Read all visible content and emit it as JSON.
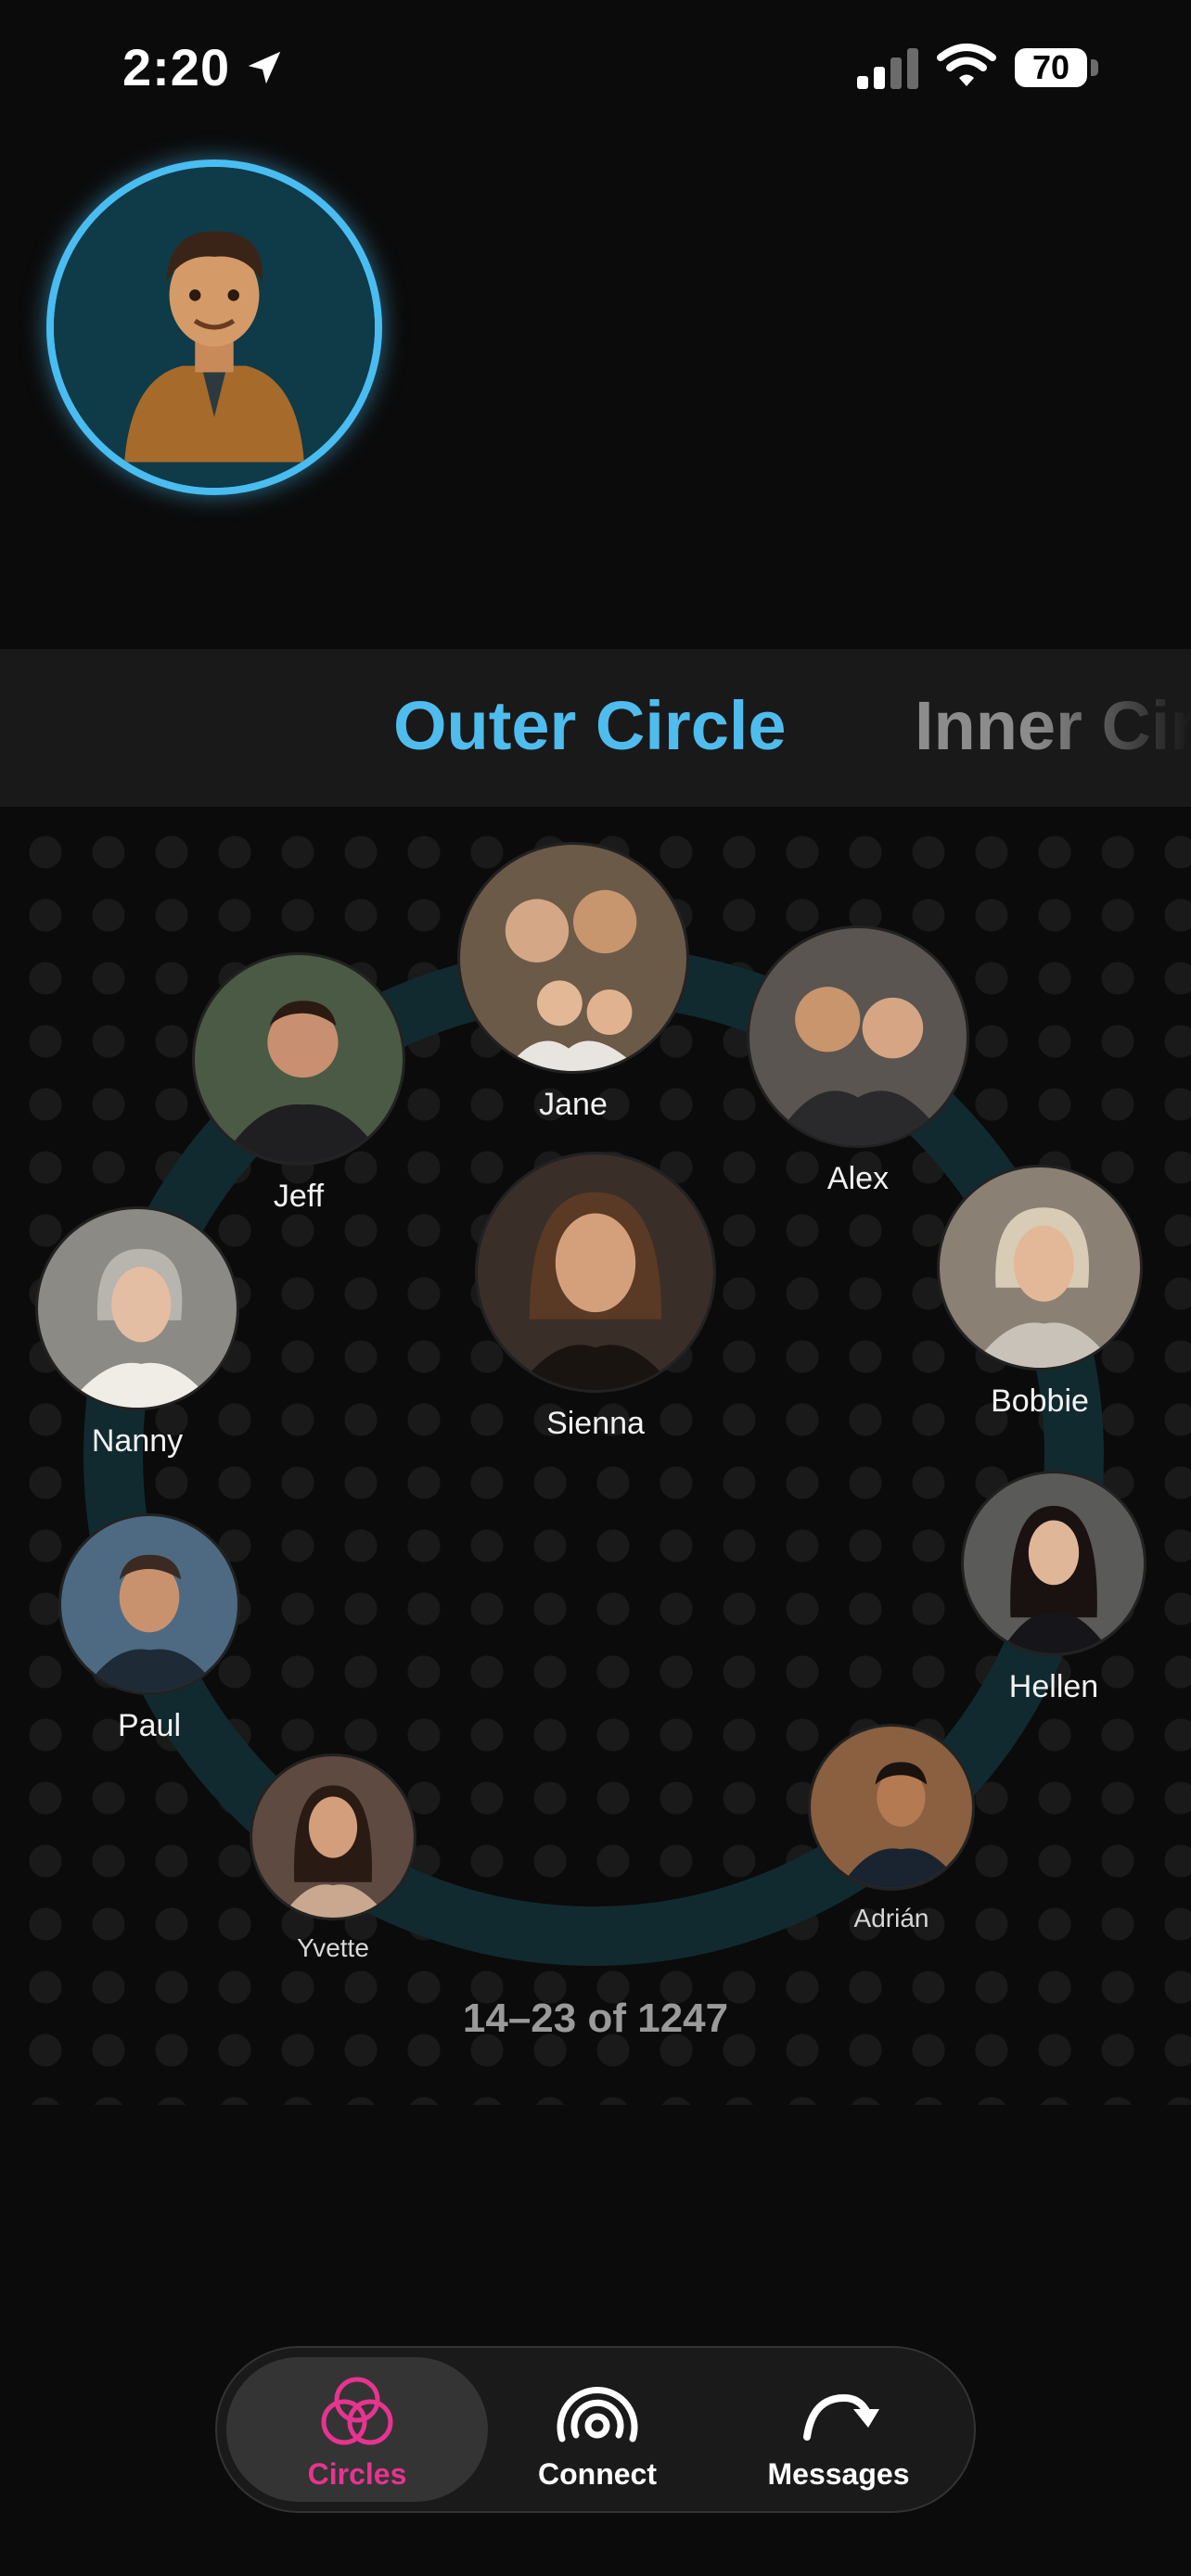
{
  "status": {
    "time": "2:20",
    "battery": "70"
  },
  "tabs": {
    "active": "Outer Circle",
    "next": "Inner Circle"
  },
  "contacts": [
    {
      "name": "Jane",
      "bg": "#6b5a48"
    },
    {
      "name": "Alex",
      "bg": "#5a5550"
    },
    {
      "name": "Jeff",
      "bg": "#4b5a44"
    },
    {
      "name": "Sienna",
      "bg": "#3a2e28"
    },
    {
      "name": "Bobbie",
      "bg": "#8a8074"
    },
    {
      "name": "Nanny",
      "bg": "#8c8a84"
    },
    {
      "name": "Paul",
      "bg": "#4d6a82"
    },
    {
      "name": "Hellen",
      "bg": "#5a5a58"
    },
    {
      "name": "Adrián",
      "bg": "#8a6040"
    },
    {
      "name": "Yvette",
      "bg": "#5e4a40"
    }
  ],
  "pagination": "14–23 of 1247",
  "nav": {
    "circles": "Circles",
    "connect": "Connect",
    "messages": "Messages"
  },
  "colors": {
    "accent": "#4fbcee",
    "active_nav": "#e6348f",
    "ring": "#112a30"
  }
}
